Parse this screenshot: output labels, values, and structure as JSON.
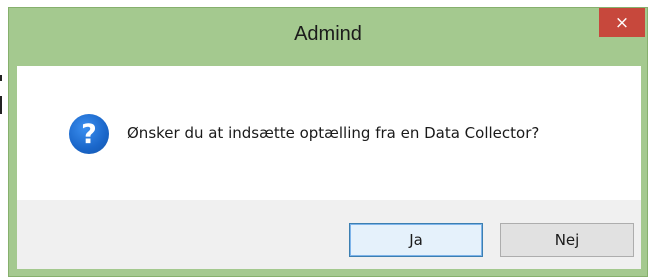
{
  "dialog": {
    "title": "Admind",
    "close_glyph": "×",
    "icon": "question-icon",
    "icon_glyph": "?",
    "message": "Ønsker du at indsætte optælling fra en Data Collector?",
    "buttons": {
      "yes_label": "Ja",
      "no_label": "Nej"
    }
  },
  "colors": {
    "frame": "#a4c98f",
    "close_button": "#c7483c",
    "footer": "#f0f0f0",
    "icon": "#1a66c9"
  }
}
